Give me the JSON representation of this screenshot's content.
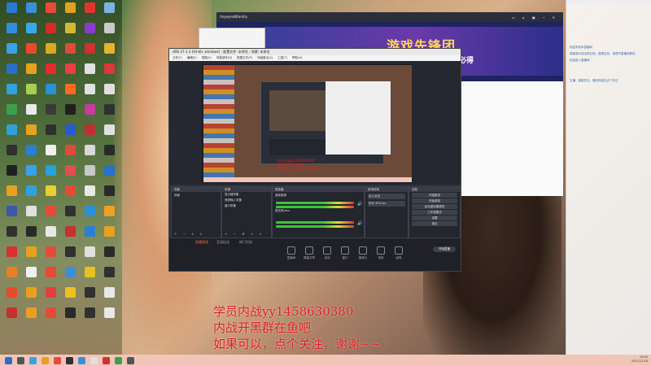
{
  "desktop": {
    "icons": [
      {
        "label": "",
        "color": "#2b79d4"
      },
      {
        "label": "",
        "color": "#3a8fd8"
      },
      {
        "label": "",
        "color": "#e84a3a"
      },
      {
        "label": "",
        "color": "#e0a020"
      },
      {
        "label": "",
        "color": "#e0342c"
      },
      {
        "label": "",
        "color": "#7bb3e0"
      },
      {
        "label": "",
        "color": "#2e8fe0"
      },
      {
        "label": "",
        "color": "#38a8e8"
      },
      {
        "label": "",
        "color": "#d82a2a"
      },
      {
        "label": "",
        "color": "#d4b832"
      },
      {
        "label": "",
        "color": "#8a3ad0"
      },
      {
        "label": "",
        "color": "#c9c9c9"
      },
      {
        "label": "",
        "color": "#3aa0e8"
      },
      {
        "label": "",
        "color": "#e84a2a"
      },
      {
        "label": "",
        "color": "#d8a820"
      },
      {
        "label": "",
        "color": "#e04a3a"
      },
      {
        "label": "",
        "color": "#d03030"
      },
      {
        "label": "",
        "color": "#e8b030"
      },
      {
        "label": "",
        "color": "#2a70c8"
      },
      {
        "label": "",
        "color": "#e8a020"
      },
      {
        "label": "",
        "color": "#e82a2a"
      },
      {
        "label": "",
        "color": "#e84040"
      },
      {
        "label": "",
        "color": "#e0e0e0"
      },
      {
        "label": "",
        "color": "#d83a3a"
      },
      {
        "label": "",
        "color": "#30a0e0"
      },
      {
        "label": "",
        "color": "#a8d050"
      },
      {
        "label": "",
        "color": "#2a90d8"
      },
      {
        "label": "",
        "color": "#ff6a20"
      },
      {
        "label": "",
        "color": "#e0e0e0"
      },
      {
        "label": "",
        "color": "#e0e0e0"
      },
      {
        "label": "",
        "color": "#3aa050"
      },
      {
        "label": "",
        "color": "#e8e8e8"
      },
      {
        "label": "",
        "color": "#3a3a3a"
      },
      {
        "label": "",
        "color": "#202020"
      },
      {
        "label": "",
        "color": "#c83aa0"
      },
      {
        "label": "",
        "color": "#303030"
      },
      {
        "label": "",
        "color": "#30a0d8"
      },
      {
        "label": "",
        "color": "#e8a020"
      },
      {
        "label": "",
        "color": "#303030"
      },
      {
        "label": "",
        "color": "#2a5ad0"
      },
      {
        "label": "",
        "color": "#c03030"
      },
      {
        "label": "",
        "color": "#e0e0e0"
      },
      {
        "label": "",
        "color": "#303030"
      },
      {
        "label": "",
        "color": "#2a80d0"
      },
      {
        "label": "",
        "color": "#f0f0f0"
      },
      {
        "label": "",
        "color": "#e04a3a"
      },
      {
        "label": "",
        "color": "#d8d8d8"
      },
      {
        "label": "",
        "color": "#2a2a2a"
      },
      {
        "label": "",
        "color": "#202020"
      },
      {
        "label": "",
        "color": "#3aa0e8"
      },
      {
        "label": "",
        "color": "#2aa0d8"
      },
      {
        "label": "",
        "color": "#e05050"
      },
      {
        "label": "",
        "color": "#c8c8c8"
      },
      {
        "label": "",
        "color": "#2a70c8"
      },
      {
        "label": "",
        "color": "#e8a020"
      },
      {
        "label": "",
        "color": "#30a0e0"
      },
      {
        "label": "",
        "color": "#e8d030"
      },
      {
        "label": "",
        "color": "#e84a3a"
      },
      {
        "label": "",
        "color": "#e8e8e8"
      },
      {
        "label": "",
        "color": "#2a2a2a"
      },
      {
        "label": "",
        "color": "#3a5aa8"
      },
      {
        "label": "",
        "color": "#e0e0e0"
      },
      {
        "label": "",
        "color": "#e84a3a"
      },
      {
        "label": "",
        "color": "#303030"
      },
      {
        "label": "",
        "color": "#2a90d8"
      },
      {
        "label": "",
        "color": "#f0a020"
      },
      {
        "label": "",
        "color": "#303030"
      },
      {
        "label": "",
        "color": "#2a2a2a"
      },
      {
        "label": "",
        "color": "#e8e8e8"
      },
      {
        "label": "",
        "color": "#c83030"
      },
      {
        "label": "",
        "color": "#2a80d0"
      },
      {
        "label": "",
        "color": "#e8a020"
      },
      {
        "label": "",
        "color": "#d83030"
      },
      {
        "label": "",
        "color": "#e8a020"
      },
      {
        "label": "",
        "color": "#e84a3a"
      },
      {
        "label": "",
        "color": "#303030"
      },
      {
        "label": "",
        "color": "#e0e0e0"
      },
      {
        "label": "",
        "color": "#2a2a2a"
      },
      {
        "label": "",
        "color": "#e88020"
      },
      {
        "label": "",
        "color": "#f0f0f0"
      },
      {
        "label": "",
        "color": "#e84a3a"
      },
      {
        "label": "",
        "color": "#3a8fd8"
      },
      {
        "label": "",
        "color": "#e8c020"
      },
      {
        "label": "",
        "color": "#303030"
      },
      {
        "label": "",
        "color": "#e84a2a"
      },
      {
        "label": "",
        "color": "#e8a020"
      },
      {
        "label": "",
        "color": "#e04040"
      },
      {
        "label": "",
        "color": "#f0c020"
      },
      {
        "label": "",
        "color": "#303030"
      },
      {
        "label": "",
        "color": "#e8e8e8"
      },
      {
        "label": "",
        "color": "#c83030"
      },
      {
        "label": "",
        "color": "#e8a020"
      },
      {
        "label": "",
        "color": "#e84a3a"
      },
      {
        "label": "",
        "color": "#2a2a2a"
      },
      {
        "label": "",
        "color": "#303030"
      },
      {
        "label": "",
        "color": "#e8e8e8"
      }
    ]
  },
  "game_window": {
    "title": "tinyeyes的Family",
    "banner_text": "游戏先锋团",
    "banner_sub": "入必得"
  },
  "obs": {
    "title": "OBS 27.1.3 (64-bit, windows) - 配置文件: 未命名 - 场景: 未命名",
    "menu": [
      "文件(F)",
      "编辑(E)",
      "视图(V)",
      "停靠部件(D)",
      "配置文件(P)",
      "场景集合(S)",
      "工具(T)",
      "帮助(H)"
    ],
    "docks": {
      "scenes": {
        "title": "场景",
        "items": [
          "场景"
        ]
      },
      "sources": {
        "title": "来源",
        "items": [
          "显示器采集",
          "音频输入采集",
          "窗口采集"
        ]
      },
      "mixer": {
        "title": "混音器",
        "channels": [
          "桌面音频",
          "麦克风/Aux"
        ]
      },
      "transitions": {
        "title": "转场特效",
        "items": [
          "淡入淡出",
          "时长 300 ms"
        ]
      },
      "controls": {
        "title": "控制",
        "buttons": [
          "开始推流",
          "开始录制",
          "启动虚拟摄像机",
          "工作室模式",
          "设置",
          "退出"
        ]
      }
    },
    "bottom": {
      "tabs": [
        "直播画面",
        "互动玩法",
        "热门活动"
      ],
      "actions": [
        "直播间",
        "屏幕共享",
        "游戏",
        "窗口",
        "摄像头",
        "语音",
        "画笔"
      ],
      "start_label": "开始直播"
    }
  },
  "overlay_text": {
    "line1": "学员内战yy1458630380",
    "line2": "内战开黑群在鱼吧",
    "line3": "如果可以，点个关注，谢谢~~"
  },
  "chat": {
    "messages": [
      "欢迎来到本直播间",
      "感谢观众送出的礼物，感谢支持，请遵守直播间规则",
      "欢迎进入直播间",
      "主播：感谢关注，喜欢的朋友点个关注"
    ]
  },
  "taskbar": {
    "time": "19:53",
    "date": "2021/12/18"
  }
}
